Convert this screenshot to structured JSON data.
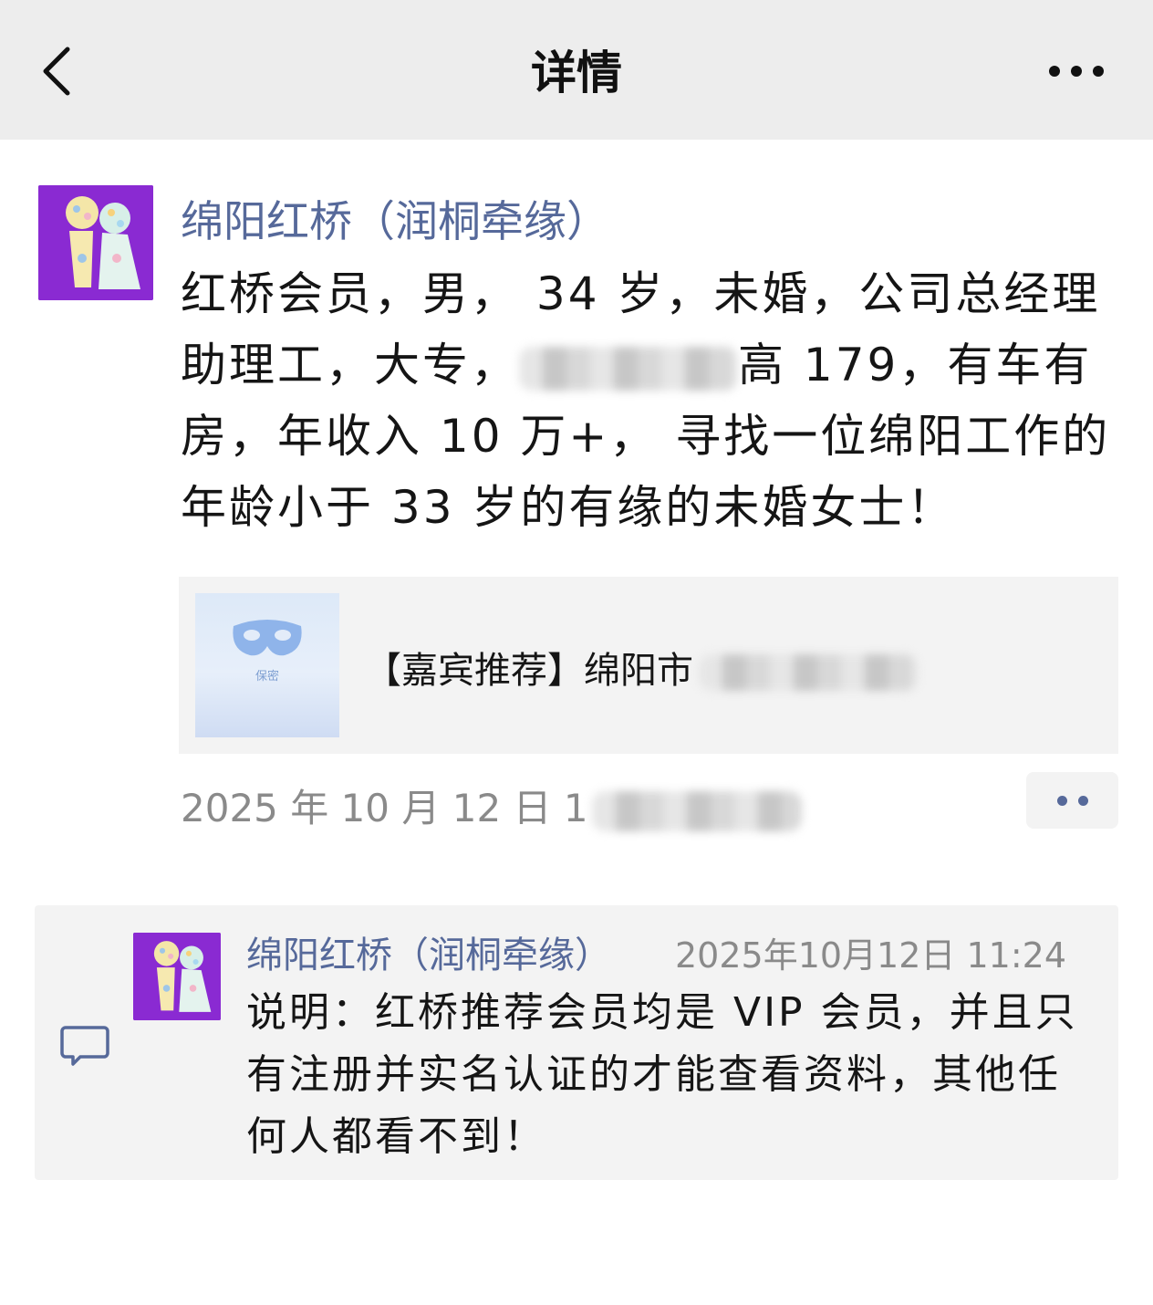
{
  "navbar": {
    "title": "详情",
    "back_icon": "chevron-left-icon",
    "more_icon": "ellipsis-icon"
  },
  "post": {
    "author": "绵阳红桥（润桐牵缘）",
    "avatar_icon": "couple-avatar",
    "text_part1": "红桥会员，男， 34 岁，未婚，公司总经理助理工，大专，",
    "text_part2": "高 179，有车有房，年收入 10 万+， 寻找一位绵阳工作的年龄小于 33 岁的有缘的未婚女士！",
    "share_card": {
      "thumb_label": "保密",
      "thumb_icon": "mask-icon",
      "title": "【嘉宾推荐】绵阳市"
    },
    "time_visible": "2025 年 10 月 12 日 1",
    "more_icon": "two-dots-icon"
  },
  "comment": {
    "icon": "comment-icon",
    "author": "绵阳红桥（润桐牵缘）",
    "time": "2025年10月12日 11:24",
    "text": "说明：红桥推荐会员均是 VIP 会员，并且只有注册并实名认证的才能查看资料，其他任何人都看不到！"
  },
  "colors": {
    "navbar_bg": "#ededed",
    "name_link": "#56699a",
    "avatar_bg": "#8a2ad2",
    "card_bg": "#f3f3f3",
    "time_gray": "#8a8a8a"
  }
}
